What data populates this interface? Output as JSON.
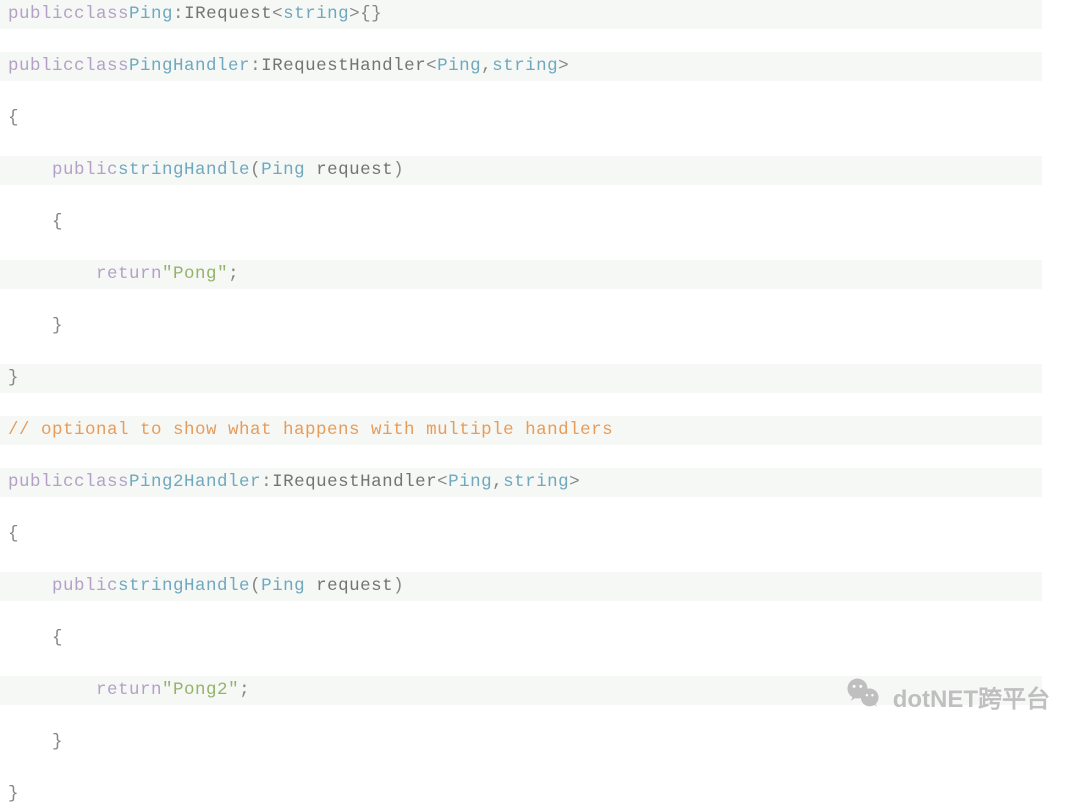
{
  "tokens": {
    "public": "public",
    "class": "class",
    "return": "return",
    "string": "string",
    "Ping": "Ping",
    "PingHandler": "PingHandler",
    "Ping2Handler": "Ping2Handler",
    "IRequest": "IRequest",
    "IRequestHandler": "IRequestHandler",
    "Handle": "Handle",
    "request": "request",
    "Pong": "Pong",
    "Pong2": "Pong2",
    "comment_multiple_handlers": "// optional to show what happens with multiple handlers"
  },
  "punct": {
    "lt": "<",
    "gt": ">",
    "colon": ":",
    "comma": ",",
    "lbrace": "{",
    "rbrace": "}",
    "lparen": "(",
    "rparen": ")",
    "semicolon": ";",
    "quote": "\"",
    "space": " ",
    "indent1": "    ",
    "indent2": "        "
  },
  "watermark": "dotNET跨平台",
  "chart_data": null
}
